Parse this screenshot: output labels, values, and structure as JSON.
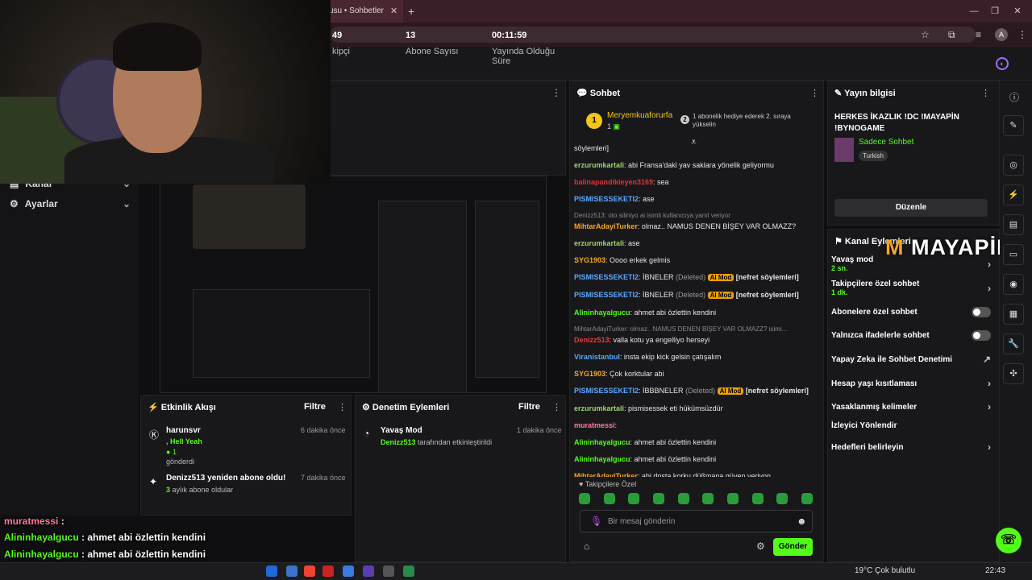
{
  "browser": {
    "tab_title": "usu • Sohbetler",
    "tab_close": "✕",
    "new_tab": "+",
    "profile_letter": "A"
  },
  "sidebar": {
    "items": [
      {
        "label": "Kanal"
      },
      {
        "label": "Ayarlar"
      }
    ]
  },
  "stats": {
    "items": [
      {
        "value": "49",
        "label": "kipçi"
      },
      {
        "value": "13",
        "label": "Abone Sayısı"
      },
      {
        "value": "00:11:59",
        "label": "Yayında Olduğu Süre"
      }
    ]
  },
  "activity": {
    "title": "Etkinlik Akışı",
    "filter": "Filtre",
    "events": [
      {
        "user": "harunsvr",
        "detail": ", Hell Yeah",
        "count": "1",
        "action": "gönderdi",
        "time": "6 dakika önce"
      },
      {
        "user": "Denizz513 yeniden abone oldu!",
        "detail": "3",
        "action": "aylık abone oldular",
        "time": "7 dakika önce"
      }
    ]
  },
  "moderation": {
    "title": "Denetim Eylemleri",
    "filter": "Filtre",
    "events": [
      {
        "title": "Yavaş Mod",
        "user": "Denizz513",
        "action": "tarafından etkinleştirildi",
        "time": "1 dakika önce"
      }
    ]
  },
  "chat": {
    "title": "Sohbet",
    "pinned_user": "Meryemkuaforurfa",
    "pinned_count": "1",
    "gift_text": "1 abonelik hediye ederek 2. sıraya yükselin",
    "gift_rank": "2",
    "messages": [
      {
        "user": "",
        "userColor": "#fff",
        "text": "söylemleri]"
      },
      {
        "user": "erzurumkartali",
        "userColor": "#9ed36a",
        "text": ": abi Fransa'daki yav saklara yönelik geliyormu"
      },
      {
        "user": "balinapandikleyen3169",
        "userColor": "#d33",
        "text": ": sea"
      },
      {
        "user": "PISMISESSEKETI2",
        "userColor": "#5aa7ff",
        "text": ": ase"
      },
      {
        "reply": "Denizz513: oto siliniyo ai isimli kullanıcıya yanıt veriyor",
        "user": "MihtarAdayiTurker",
        "userColor": "#f5a623",
        "text": ": olmaz.. NAMUS DENEN BİŞEY VAR OLMAZZ?"
      },
      {
        "user": "erzurumkartali",
        "userColor": "#9ed36a",
        "text": ": ase"
      },
      {
        "user": "SYG1903",
        "userColor": "#f5a623",
        "text": ": Oooo erkek gelmis"
      },
      {
        "user": "PISMISESSEKETI2",
        "userColor": "#5aa7ff",
        "text": ": İBNELER",
        "deleted": "(Deleted)",
        "mod": "AI Mod",
        "tag": "[nefret söylemleri]"
      },
      {
        "user": "PISMISESSEKETI2",
        "userColor": "#5aa7ff",
        "text": ": İBNELER",
        "deleted": "(Deleted)",
        "mod": "AI Mod",
        "tag": "[nefret söylemleri]"
      },
      {
        "user": "Alininhayalgucu",
        "userColor": "#53fc18",
        "text": ": ahmet abi özlettin kendini"
      },
      {
        "reply": "MihtarAdayiTurker: olmaz.. NAMUS DENEN BİŞEY VAR OLMAZZ? isimi...",
        "user": "Denizz513",
        "userColor": "#e83a3a",
        "text": ": valla kotu ya engelliyo herseyi"
      },
      {
        "user": "Viranistanbul",
        "userColor": "#5aa7ff",
        "text": ": insta ekip kick gelsin çatışalım"
      },
      {
        "user": "SYG1903",
        "userColor": "#f5a623",
        "text": ": Çok korktular abi"
      },
      {
        "user": "PISMISESSEKETI2",
        "userColor": "#5aa7ff",
        "text": ": İBBBNELER",
        "deleted": "(Deleted)",
        "mod": "AI Mod",
        "tag": "[nefret söylemleri]"
      },
      {
        "user": "erzurumkartali",
        "userColor": "#9ed36a",
        "text": ": pismisessek eti hükümsüzdür"
      },
      {
        "user": "muratmessi",
        "userColor": "#ff7a9a",
        "text": ":"
      },
      {
        "user": "Alininhayalgucu",
        "userColor": "#53fc18",
        "text": ": ahmet abi özlettin kendini"
      },
      {
        "user": "Alininhayalgucu",
        "userColor": "#53fc18",
        "text": ": ahmet abi özlettin kendini"
      },
      {
        "user": "MihtarAdayiTurker",
        "userColor": "#f5a623",
        "text": ": abi dosta korku düßmana güven veriyon"
      }
    ],
    "followers_only": "Takipçilere Özel",
    "input_placeholder": "Bir mesaj gönderin",
    "send": "Gönder"
  },
  "stream_info": {
    "title": "Yayın bilgisi",
    "stream_title": "HERKES İKAZLIK !DC !MAYAPİN !BYNOGAME",
    "category": "Sadece Sohbet",
    "language": "Turkish",
    "edit": "Düzenle"
  },
  "channel_actions": {
    "title": "Kanal Eylemleri",
    "items": [
      {
        "label": "Yavaş mod",
        "sub": "2 sn.",
        "type": "chev"
      },
      {
        "label": "Takipçilere özel sohbet",
        "sub": "1 dk.",
        "type": "chev"
      },
      {
        "label": "Abonelere özel sohbet",
        "sub": "",
        "type": "toggle"
      },
      {
        "label": "Yalnızca ifadelerle sohbet",
        "sub": "",
        "type": "toggle"
      },
      {
        "label": "Yapay Zeka ile Sohbet Denetimi",
        "sub": "",
        "type": "ext"
      },
      {
        "label": "Hesap yaşı kısıtlaması",
        "sub": "",
        "type": "chev"
      },
      {
        "label": "Yasaklanmış kelimeler",
        "sub": "",
        "type": "chev"
      },
      {
        "label": "İzleyici Yönlendir",
        "sub": "",
        "type": "none"
      },
      {
        "label": "Hedefleri belirleyin",
        "sub": "",
        "type": "chev"
      }
    ]
  },
  "logo": {
    "text": "MAYAPİN",
    "initial": "M"
  },
  "overlay": {
    "lines": [
      {
        "user": "muratmessi",
        "text": " :"
      },
      {
        "user": "Alininhayalgucu",
        "text": " : ahmet abi özlettin kendini"
      },
      {
        "user": "Alininhayalgucu",
        "text": " : ahmet abi özlettin kendini"
      },
      {
        "user": "MihtarAdayiTurker",
        "text": " : abi dosta korku düßmana güven veriyon"
      }
    ]
  },
  "taskbar": {
    "weather": "19°C  Çok bulutlu",
    "time": "22:43"
  },
  "colors": {
    "accent": "#53fc18",
    "mod": "#f0a000",
    "panel": "#18181b"
  }
}
